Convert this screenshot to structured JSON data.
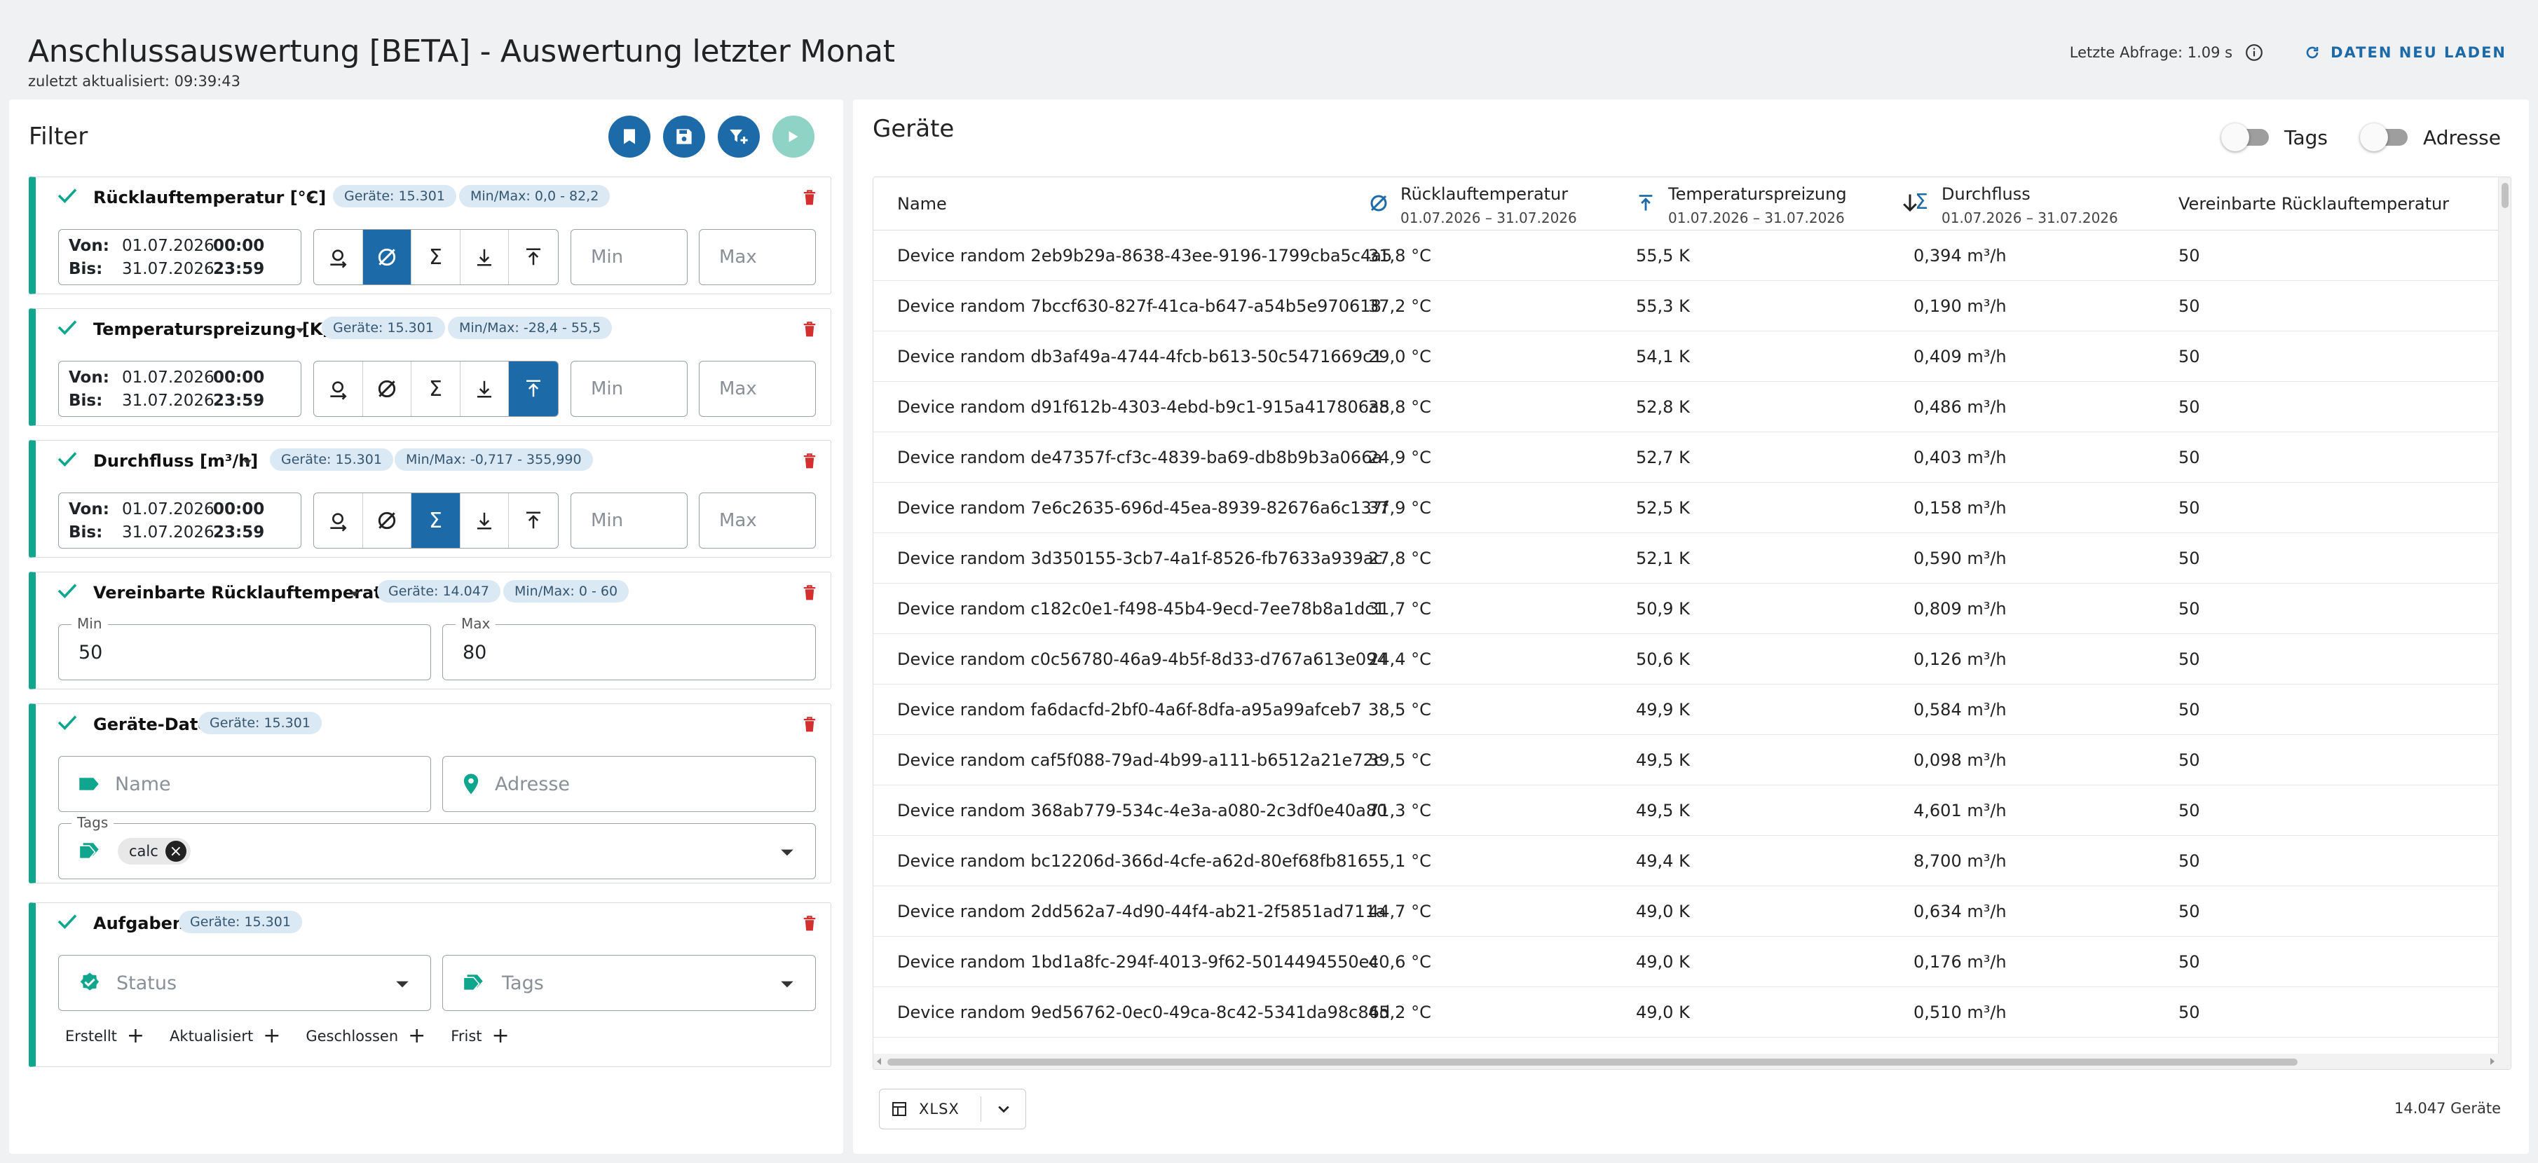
{
  "header": {
    "title": "Anschlussauswertung [BETA] - Auswertung letzter Monat",
    "updated": "zuletzt aktualisiert: 09:39:43",
    "last_query": "Letzte Abfrage: 1.09 s",
    "reload_label": "DATEN NEU LADEN"
  },
  "filter": {
    "title": "Filter",
    "cards": [
      {
        "title": "Rücklauftemperatur [°C]",
        "devices": "Geräte: 15.301",
        "minmax": "Min/Max: 0,0 - 82,2",
        "active_mode": "avg"
      },
      {
        "title": "Temperaturspreizung [K]",
        "devices": "Geräte: 15.301",
        "minmax": "Min/Max: -28,4 - 55,5",
        "active_mode": "max"
      },
      {
        "title": "Durchfluss [m³/h]",
        "devices": "Geräte: 15.301",
        "minmax": "Min/Max: -0,717 - 355,990",
        "active_mode": "sum"
      }
    ],
    "date": {
      "from_label": "Von:",
      "to_label": "Bis:",
      "from_date": "01.07.2026",
      "from_time": "00:00",
      "to_date": "31.07.2026",
      "to_time": "23:59"
    },
    "min_placeholder": "Min",
    "max_placeholder": "Max",
    "agreed": {
      "title": "Vereinbarte Rücklauftemperatur",
      "devices": "Geräte: 14.047",
      "minmax": "Min/Max: 0 - 60",
      "min_label": "Min",
      "min_value": "50",
      "max_label": "Max",
      "max_value": "80"
    },
    "device_data": {
      "title": "Geräte-Daten",
      "devices": "Geräte: 15.301",
      "name_placeholder": "Name",
      "address_placeholder": "Adresse",
      "tags_label": "Tags",
      "chip": "calc"
    },
    "tasks": {
      "title": "Aufgaben",
      "devices": "Geräte: 15.301",
      "status_placeholder": "Status",
      "tags_placeholder": "Tags",
      "date_fields": [
        "Erstellt",
        "Aktualisiert",
        "Geschlossen",
        "Frist"
      ]
    }
  },
  "devices": {
    "title": "Geräte",
    "toggles": {
      "tags": "Tags",
      "address": "Adresse"
    },
    "columns": {
      "name": "Name",
      "ruecklauf": "Rücklauftemperatur",
      "spreizung": "Temperaturspreizung",
      "durchfluss": "Durchfluss",
      "vereinbart": "Vereinbarte Rücklauftemperatur",
      "range": "01.07.2026 – 31.07.2026"
    },
    "rows": [
      {
        "name": "Device random 2eb9b29a-8638-43ee-9196-1799cba5c4a5",
        "temp": "31,8 °C",
        "spread": "55,5 K",
        "flow": "0,394 m³/h",
        "agreed": "50"
      },
      {
        "name": "Device random 7bccf630-827f-41ca-b647-a54b5e970618",
        "temp": "37,2 °C",
        "spread": "55,3 K",
        "flow": "0,190 m³/h",
        "agreed": "50"
      },
      {
        "name": "Device random db3af49a-4744-4fcb-b613-50c5471669c1",
        "temp": "29,0 °C",
        "spread": "54,1 K",
        "flow": "0,409 m³/h",
        "agreed": "50"
      },
      {
        "name": "Device random d91f612b-4303-4ebd-b9c1-915a417806a5",
        "temp": "38,8 °C",
        "spread": "52,8 K",
        "flow": "0,486 m³/h",
        "agreed": "50"
      },
      {
        "name": "Device random de47357f-cf3c-4839-ba69-db8b9b3a066a",
        "temp": "24,9 °C",
        "spread": "52,7 K",
        "flow": "0,403 m³/h",
        "agreed": "50"
      },
      {
        "name": "Device random 7e6c2635-696d-45ea-8939-82676a6c137f",
        "temp": "37,9 °C",
        "spread": "52,5 K",
        "flow": "0,158 m³/h",
        "agreed": "50"
      },
      {
        "name": "Device random 3d350155-3cb7-4a1f-8526-fb7633a939ac",
        "temp": "27,8 °C",
        "spread": "52,1 K",
        "flow": "0,590 m³/h",
        "agreed": "50"
      },
      {
        "name": "Device random c182c0e1-f498-45b4-9ecd-7ee78b8a1dc1",
        "temp": "31,7 °C",
        "spread": "50,9 K",
        "flow": "0,809 m³/h",
        "agreed": "50"
      },
      {
        "name": "Device random c0c56780-46a9-4b5f-8d33-d767a613e094",
        "temp": "24,4 °C",
        "spread": "50,6 K",
        "flow": "0,126 m³/h",
        "agreed": "50"
      },
      {
        "name": "Device random fa6dacfd-2bf0-4a6f-8dfa-a95a99afceb7",
        "temp": "38,5 °C",
        "spread": "49,9 K",
        "flow": "0,584 m³/h",
        "agreed": "50"
      },
      {
        "name": "Device random caf5f088-79ad-4b99-a111-b6512a21e72c",
        "temp": "39,5 °C",
        "spread": "49,5 K",
        "flow": "0,098 m³/h",
        "agreed": "50"
      },
      {
        "name": "Device random 368ab779-534c-4e3a-a080-2c3df0e40a80",
        "temp": "71,3 °C",
        "spread": "49,5 K",
        "flow": "4,601 m³/h",
        "agreed": "50"
      },
      {
        "name": "Device random bc12206d-366d-4cfe-a62d-80ef68fb816",
        "temp": "55,1 °C",
        "spread": "49,4 K",
        "flow": "8,700 m³/h",
        "agreed": "50"
      },
      {
        "name": "Device random 2dd562a7-4d90-44f4-ab21-2f5851ad711a",
        "temp": "44,7 °C",
        "spread": "49,0 K",
        "flow": "0,634 m³/h",
        "agreed": "50"
      },
      {
        "name": "Device random 1bd1a8fc-294f-4013-9f62-5014494550ec",
        "temp": "40,6 °C",
        "spread": "49,0 K",
        "flow": "0,176 m³/h",
        "agreed": "50"
      },
      {
        "name": "Device random 9ed56762-0ec0-49ca-8c42-5341da98c86d",
        "temp": "45,2 °C",
        "spread": "49,0 K",
        "flow": "0,510 m³/h",
        "agreed": "50"
      }
    ],
    "export_label": "XLSX",
    "count": "14.047 Geräte"
  },
  "colors": {
    "primary": "#1c6aa8",
    "accent": "#10a58d",
    "danger": "#d32f2f"
  }
}
